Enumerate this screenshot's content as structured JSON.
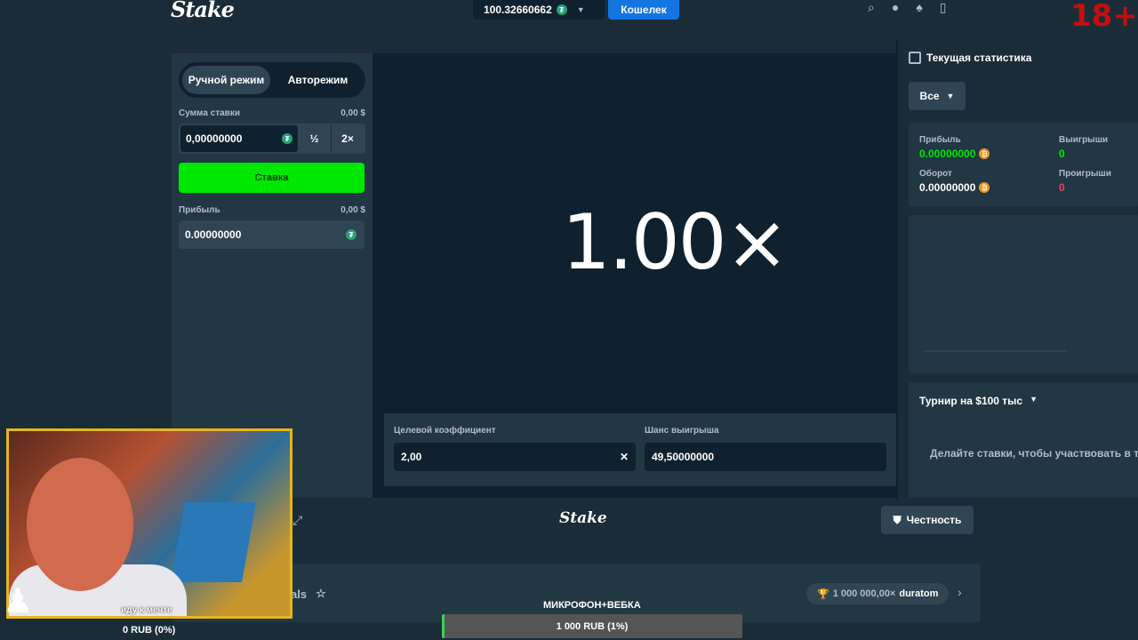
{
  "header": {
    "logo": "Stake",
    "balance": "100.32660662",
    "wallet_button": "Кошелек",
    "age_badge": "18+"
  },
  "bet_panel": {
    "tab_manual": "Ручной режим",
    "tab_auto": "Авторежим",
    "bet_amount_label": "Сумма ставки",
    "bet_amount_usd": "0,00 $",
    "bet_amount_value": "0,00000000",
    "half_button": "½",
    "double_button": "2×",
    "bet_button": "Ставка",
    "profit_label": "Прибыль",
    "profit_usd": "0,00 $",
    "profit_value": "0.00000000"
  },
  "game": {
    "multiplier": "1.00×",
    "target_multiplier_label": "Целевой коэффициент",
    "target_multiplier_value": "2,00",
    "win_chance_label": "Шанс выигрыша",
    "win_chance_value": "49,50000000"
  },
  "stats": {
    "title": "Текущая статистика",
    "filter": "Все",
    "profit_label": "Прибыль",
    "profit_value": "0.00000000",
    "wins_label": "Выигрыши",
    "wins_value": "0",
    "wagered_label": "Оборот",
    "wagered_value": "0.00000000",
    "losses_label": "Проигрыши",
    "losses_value": "0",
    "tournament_title": "Турнир на $100 тыс",
    "tournament_note": "Делайте ставки, чтобы участвовать в тур"
  },
  "footer": {
    "logo": "Stake",
    "fairness_button": "Честность",
    "originals_fragment": "als",
    "trophy_amount": "1 000 000,00×",
    "trophy_user": "duratom"
  },
  "overlay": {
    "cam_caption": "иду к мечте",
    "goal_text": "0 RUB (0%)",
    "mic_label": "МИКРОФОН+ВЕБКА",
    "goal_bar_text": "1 000 RUB (1%)",
    "goal_bar_progress": 0.01
  },
  "colors": {
    "accent_green": "#00e701",
    "wallet_blue": "#1475e1",
    "loss_red": "#ed4163"
  }
}
